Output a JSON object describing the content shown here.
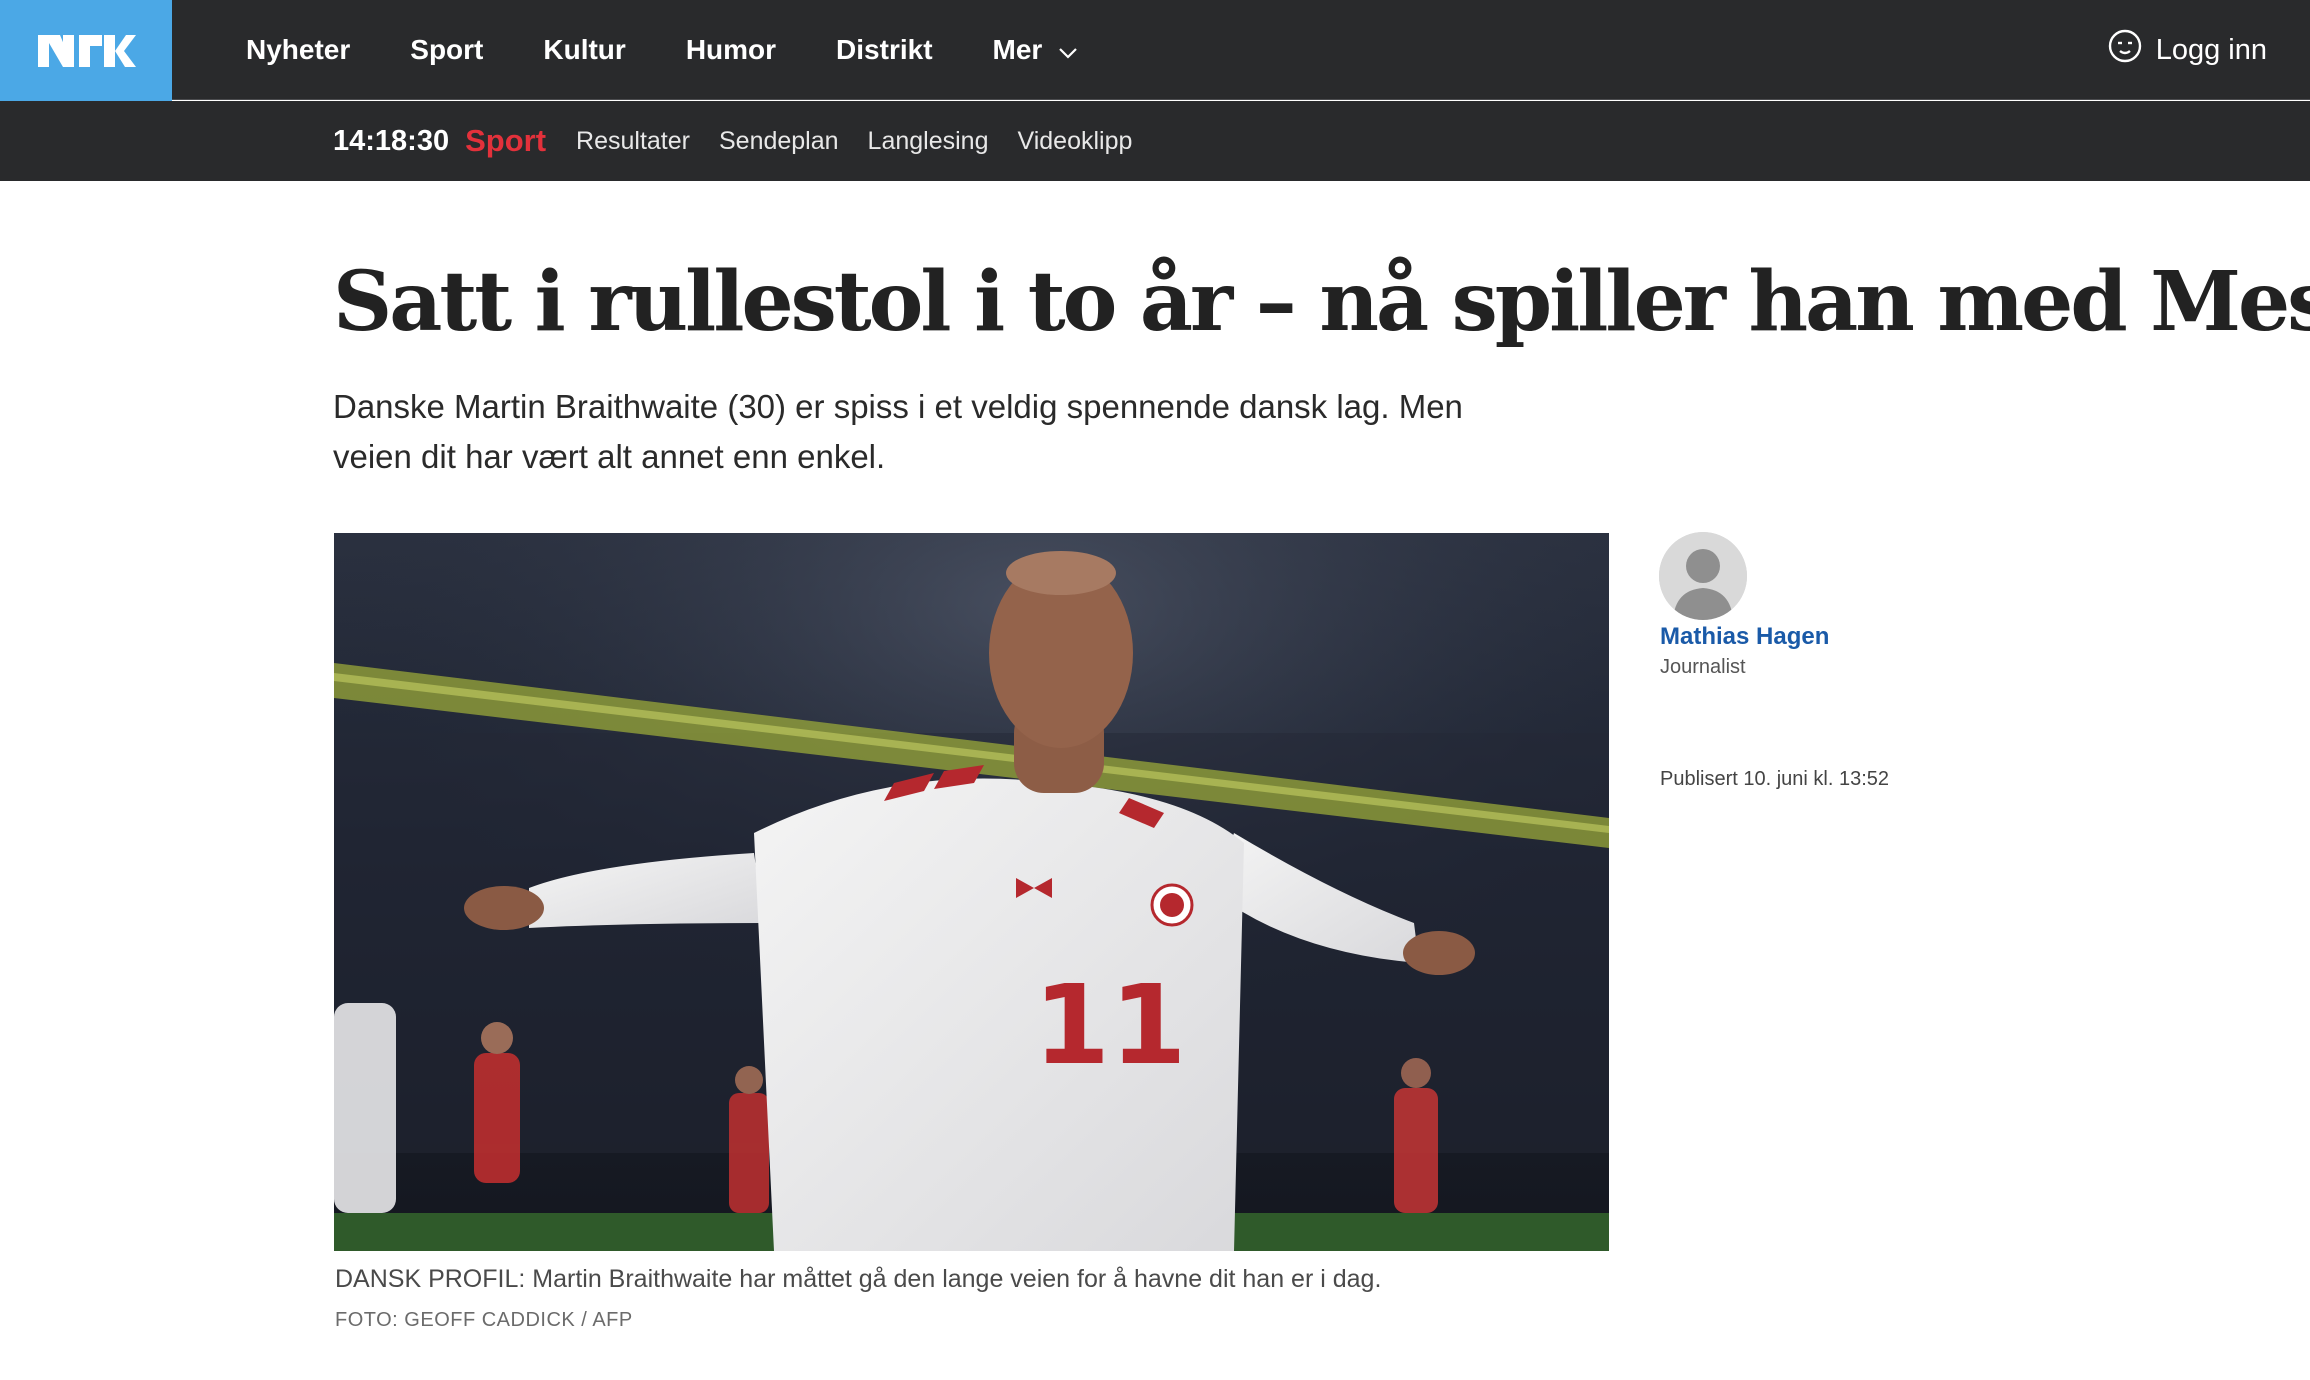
{
  "brand": {
    "logo_text": "NRK",
    "logo_color": "#4ba8e6"
  },
  "nav": {
    "items": [
      "Nyheter",
      "Sport",
      "Kultur",
      "Humor",
      "Distrikt",
      "Mer"
    ],
    "more_icon": "chevron-down-icon",
    "login_label": "Logg inn",
    "login_icon": "user-face-icon"
  },
  "subnav": {
    "clock": "14:18:30",
    "section": "Sport",
    "section_color": "#e3313b",
    "links": [
      "Resultater",
      "Sendeplan",
      "Langlesing",
      "Videoklipp"
    ]
  },
  "article": {
    "title": "Satt i rullestol i to år – nå spiller han med Messi",
    "lead": "Danske Martin Braithwaite (30) er spiss i et veldig spennende dansk lag. Men veien dit har vært alt annet enn enkel.",
    "image": {
      "jersey_number": "11",
      "caption": "DANSK PROFIL: Martin Braithwaite har måttet gå den lange veien for å havne dit han er i dag.",
      "credit": "FOTO: GEOFF CADDICK / AFP"
    },
    "byline": {
      "name": "Mathias Hagen",
      "role": "Journalist",
      "name_color": "#1a5aa8"
    },
    "published": "Publisert 10. juni kl. 13:52"
  }
}
